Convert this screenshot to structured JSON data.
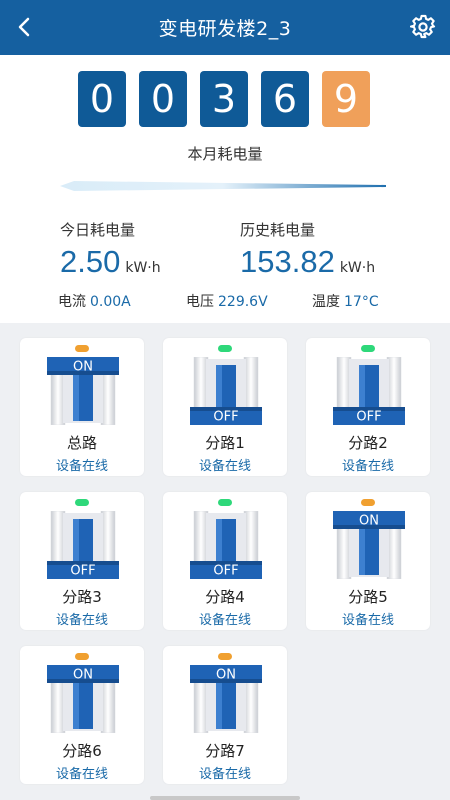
{
  "header": {
    "title": "变电研发楼2_3",
    "back_icon": "back-arrow-icon",
    "settings_icon": "gear-icon"
  },
  "meter_display": {
    "digits": [
      "0",
      "0",
      "3",
      "6",
      "9"
    ],
    "label": "本月耗电量"
  },
  "today": {
    "label": "今日耗电量",
    "value": "2.50",
    "unit": "kW·h"
  },
  "history": {
    "label": "历史耗电量",
    "value": "153.82",
    "unit": "kW·h"
  },
  "readings": {
    "current": {
      "label": "电流",
      "value": "0.00A"
    },
    "voltage": {
      "label": "电压",
      "value": "229.6V"
    },
    "temperature": {
      "label": "温度",
      "value": "17°C"
    }
  },
  "colors": {
    "header": "#1560a0",
    "accent_digit": "#f0a05a",
    "value_text": "#1a6aa8",
    "led_on": "#f0a030",
    "led_off": "#2ed87a"
  },
  "switches": [
    {
      "name": "总路",
      "status": "设备在线",
      "state": "ON"
    },
    {
      "name": "分路1",
      "status": "设备在线",
      "state": "OFF"
    },
    {
      "name": "分路2",
      "status": "设备在线",
      "state": "OFF"
    },
    {
      "name": "分路3",
      "status": "设备在线",
      "state": "OFF"
    },
    {
      "name": "分路4",
      "status": "设备在线",
      "state": "OFF"
    },
    {
      "name": "分路5",
      "status": "设备在线",
      "state": "ON"
    },
    {
      "name": "分路6",
      "status": "设备在线",
      "state": "ON"
    },
    {
      "name": "分路7",
      "status": "设备在线",
      "state": "ON"
    }
  ]
}
